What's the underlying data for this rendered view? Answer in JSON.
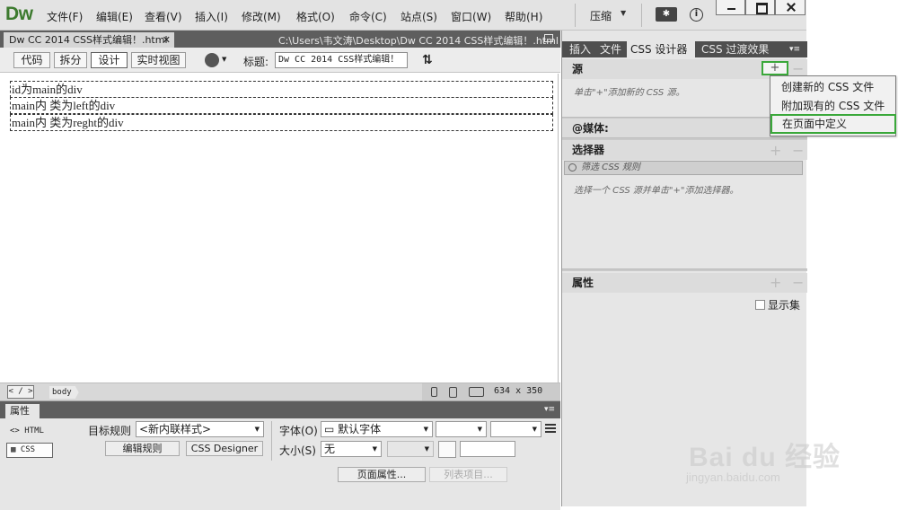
{
  "app": {
    "logo": "Dw",
    "compress_label": "压缩"
  },
  "menu": [
    "文件(F)",
    "编辑(E)",
    "查看(V)",
    "插入(I)",
    "修改(M)",
    "格式(O)",
    "命令(C)",
    "站点(S)",
    "窗口(W)",
    "帮助(H)"
  ],
  "document": {
    "tab_label": "Dw CC 2014 CSS样式编辑！.html",
    "path": "C:\\Users\\韦文涛\\Desktop\\Dw CC 2014 CSS样式编辑！.html",
    "title_label": "标题:",
    "title_value": "Dw CC 2014 CSS样式编辑！"
  },
  "view_buttons": [
    "代码",
    "拆分",
    "设计",
    "实时视图"
  ],
  "canvas": {
    "divs": [
      "id为main的div",
      "main内 类为left的div",
      "main内 类为reght的div"
    ]
  },
  "status": {
    "code_tag": "< / >",
    "tag": "body",
    "dimensions": "634 x 350"
  },
  "properties": {
    "tab": "属性",
    "html_toggle": "<> HTML",
    "css_toggle": "CSS",
    "target_rule_label": "目标规则",
    "target_rule_value": "<新内联样式>",
    "edit_rule_btn": "编辑规则",
    "css_designer_btn": "CSS Designer",
    "font_label": "字体(O)",
    "font_value": "默认字体",
    "size_label": "大小(S)",
    "size_value": "无",
    "page_props_btn": "页面属性...",
    "list_item_btn": "列表项目..."
  },
  "right_panel": {
    "tabs": [
      "插入",
      "文件",
      "CSS 设计器",
      "CSS 过渡效果"
    ],
    "sources_label": "源",
    "sources_hint": "单击\"+\"添加新的 CSS 源。",
    "media_label": "@媒体:",
    "selectors_label": "选择器",
    "filter_placeholder": "筛选 CSS 规则",
    "selectors_hint": "选择一个 CSS 源并单击\"+\"添加选择器。",
    "properties_label": "属性",
    "show_set_label": "显示集"
  },
  "popup": [
    "创建新的 CSS 文件",
    "附加现有的 CSS 文件",
    "在页面中定义"
  ],
  "watermark": {
    "text": "Bai du 经验",
    "url": "jingyan.baidu.com"
  },
  "colors": {
    "logo_green": "#3c7a2e",
    "highlight_green": "#3aa83a",
    "panel_dark": "#5e5e5e"
  }
}
